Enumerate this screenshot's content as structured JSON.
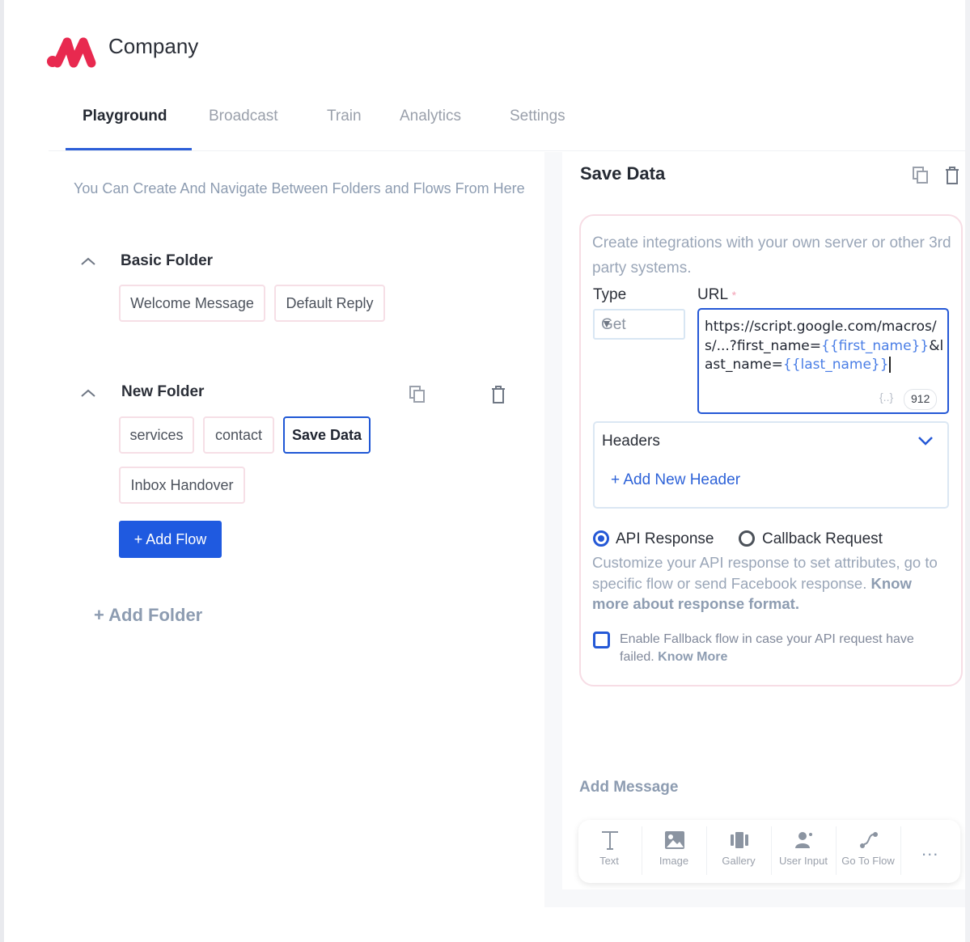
{
  "app": {
    "name": "Company"
  },
  "tabs": [
    {
      "label": "Playground",
      "active": true
    },
    {
      "label": "Broadcast"
    },
    {
      "label": "Train"
    },
    {
      "label": "Analytics"
    },
    {
      "label": "Settings"
    }
  ],
  "left": {
    "hint": "You Can Create And Navigate Between Folders and Flows From Here",
    "folders": [
      {
        "title": "Basic Folder",
        "flows": [
          "Welcome Message",
          "Default Reply"
        ]
      },
      {
        "title": "New Folder",
        "flows": [
          "services",
          "contact",
          "Save Data",
          "Inbox Handover"
        ]
      }
    ],
    "add_flow": "+ Add Flow",
    "add_folder": "+ Add Folder"
  },
  "panel": {
    "title": "Save Data",
    "description": "Create integrations with your own server or other 3rd party systems.",
    "type_label": "Type",
    "url_label": "URL",
    "required_mark": "*",
    "type_value": "Get",
    "url_prefix": "https://script.google.com/macros/s/...?first_name=",
    "url_var1": "{{first_name}}",
    "url_mid": "&last_name=",
    "url_var2": "{{last_name}}",
    "var_button": "{..}",
    "char_count": "912",
    "headers_title": "Headers",
    "add_header": "+ Add New Header",
    "response_options": [
      "API Response",
      "Callback Request"
    ],
    "response_selected": "API Response",
    "response_desc": "Customize your API response to set attributes, go to specific flow or send Facebook response.",
    "response_link": "Know more about response format.",
    "fallback_text": "Enable Fallback flow in case your API request have failed.",
    "fallback_link": "Know More",
    "add_message_title": "Add Message",
    "message_types": [
      "Text",
      "Image",
      "Gallery",
      "User Input",
      "Go To Flow"
    ],
    "more": "..."
  },
  "colors": {
    "accent": "#1f5ae0",
    "brand": "#e8294f",
    "chip_border": "#f6dfe6"
  }
}
